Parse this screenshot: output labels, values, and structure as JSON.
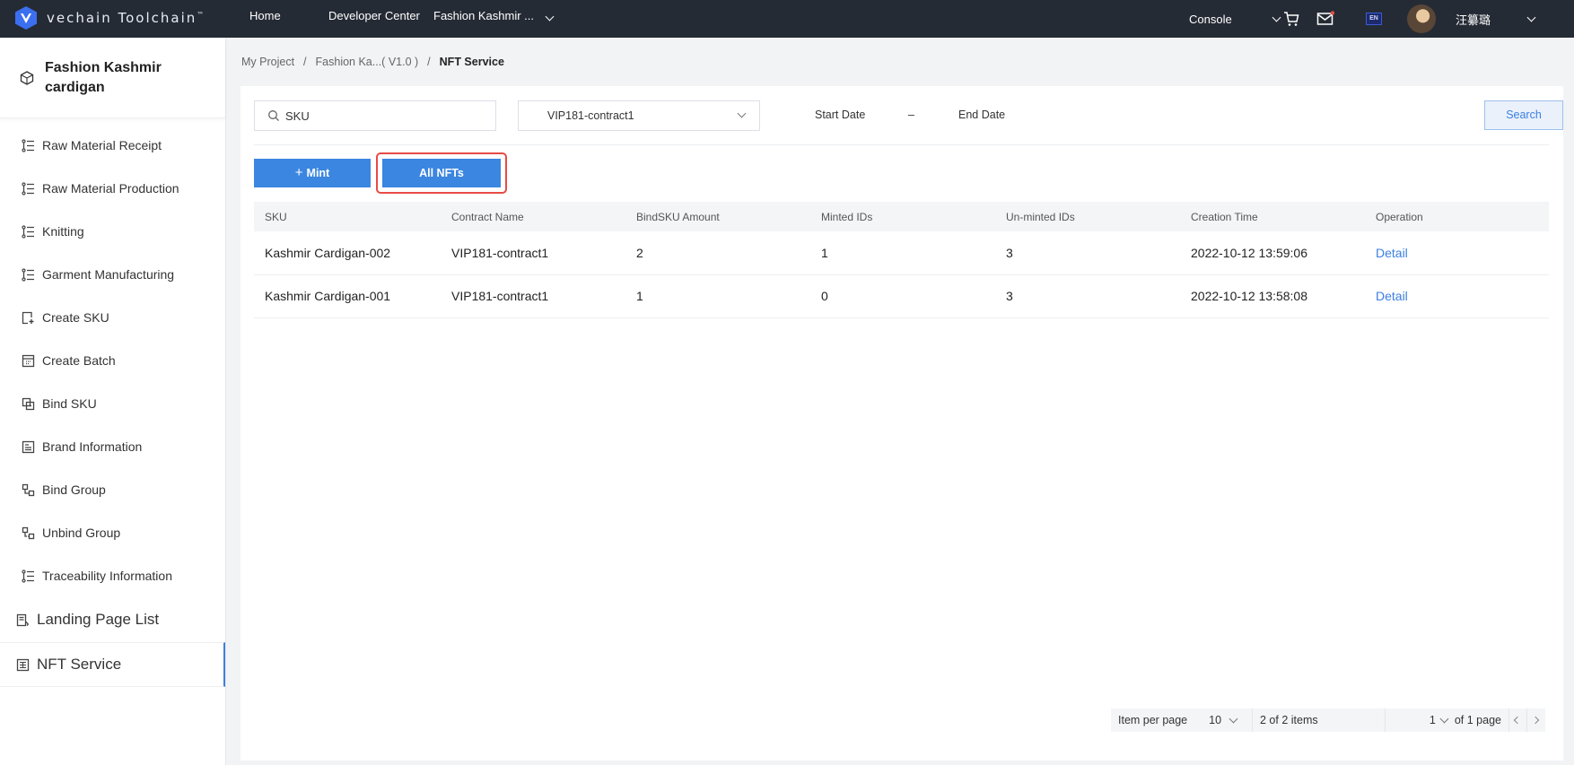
{
  "topbar": {
    "brand": "vechain Toolchain",
    "brand_tm": "™",
    "nav": [
      "Home",
      "Developer Center",
      "Fashion Kashmir ..."
    ],
    "console": "Console",
    "lang": "EN",
    "username": "汪纂璐",
    "colors": {
      "bg": "#252b35",
      "notify_dot": "#e84b45",
      "lang_badge": "#3b5bd6"
    }
  },
  "sidebar": {
    "project": "Fashion Kashmir cardigan",
    "items": [
      {
        "label": "Raw Material Receipt",
        "icon": "list-icon"
      },
      {
        "label": "Raw Material Production",
        "icon": "list-icon"
      },
      {
        "label": "Knitting",
        "icon": "list-icon"
      },
      {
        "label": "Garment Manufacturing",
        "icon": "list-icon"
      },
      {
        "label": "Create SKU",
        "icon": "add-doc-icon"
      },
      {
        "label": "Create Batch",
        "icon": "calendar-grid-icon"
      },
      {
        "label": "Bind SKU",
        "icon": "bind-icon"
      },
      {
        "label": "Brand Information",
        "icon": "card-icon"
      },
      {
        "label": "Bind Group",
        "icon": "group-icon"
      },
      {
        "label": "Unbind Group",
        "icon": "group-icon"
      },
      {
        "label": "Traceability Information",
        "icon": "list-icon"
      }
    ],
    "landing": "Landing Page List",
    "nft": "NFT Service"
  },
  "breadcrumb": [
    "My Project",
    "Fashion Ka...( V1.0 )",
    "NFT Service"
  ],
  "breadcrumb_sep": "/",
  "filters": {
    "search_placeholder": "SKU",
    "contract": "VIP181-contract1",
    "start_date": "Start Date",
    "date_sep": "–",
    "end_date": "End Date",
    "search_btn": "Search"
  },
  "actions": {
    "mint": "Mint",
    "mint_plus": "+",
    "all_nfts": "All NFTs"
  },
  "table": {
    "headers": [
      "SKU",
      "Contract Name",
      "BindSKU Amount",
      "Minted IDs",
      "Un-minted IDs",
      "Creation Time",
      "Operation"
    ],
    "rows": [
      [
        "Kashmir Cardigan-002",
        "VIP181-contract1",
        "2",
        "1",
        "3",
        "2022-10-12 13:59:06",
        "Detail"
      ],
      [
        "Kashmir Cardigan-001",
        "VIP181-contract1",
        "1",
        "0",
        "3",
        "2022-10-12 13:58:08",
        "Detail"
      ]
    ]
  },
  "pager": {
    "per_page_label": "Item per page",
    "per_page": "10",
    "items": "2 of 2 items",
    "page": "1",
    "of_pages": "of 1 page"
  }
}
